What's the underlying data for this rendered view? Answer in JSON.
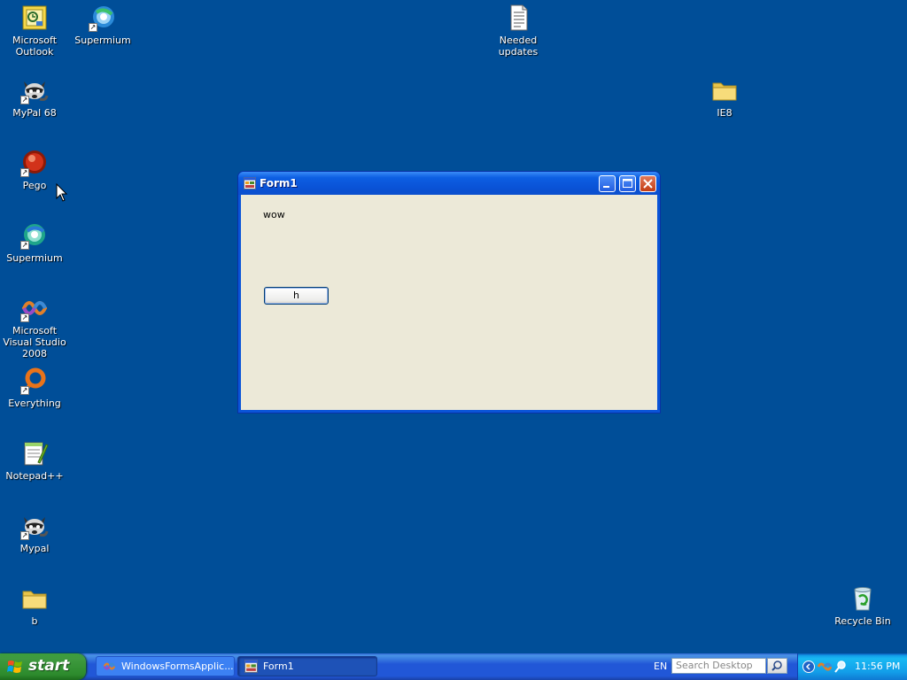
{
  "desktop": {
    "icons": [
      {
        "label": "Microsoft Outlook",
        "icon": "outlook-icon"
      },
      {
        "label": "Supermium",
        "icon": "supermium-icon"
      },
      {
        "label": "Needed updates",
        "icon": "text-document-icon"
      },
      {
        "label": "MyPal 68",
        "icon": "mypal-raccoon-icon"
      },
      {
        "label": "IE8",
        "icon": "folder-icon"
      },
      {
        "label": "Pego",
        "icon": "pego-icon"
      },
      {
        "label": "Supermium",
        "icon": "supermium-icon"
      },
      {
        "label": "Microsoft Visual Studio 2008",
        "icon": "visual-studio-icon"
      },
      {
        "label": "Everything",
        "icon": "everything-search-icon"
      },
      {
        "label": "Notepad++",
        "icon": "notepad-plus-plus-icon"
      },
      {
        "label": "Mypal",
        "icon": "mypal-raccoon-icon"
      },
      {
        "label": "b",
        "icon": "folder-icon"
      },
      {
        "label": "Recycle Bin",
        "icon": "recycle-bin-icon"
      }
    ]
  },
  "window": {
    "title": "Form1",
    "label_text": "wow",
    "button_text": "h"
  },
  "taskbar": {
    "start_label": "start",
    "tasks": [
      {
        "label": "WindowsFormsApplic...",
        "icon": "visual-studio-icon",
        "active": false
      },
      {
        "label": "Form1",
        "icon": "form-icon",
        "active": true
      }
    ],
    "language": "EN",
    "search_placeholder": "Search Desktop",
    "clock": "11:56 PM"
  },
  "colors": {
    "desktop_bg": "#004e98",
    "taskbar_blue": "#2157d7",
    "start_green": "#3f9a3f",
    "window_face": "#ece9d8"
  }
}
